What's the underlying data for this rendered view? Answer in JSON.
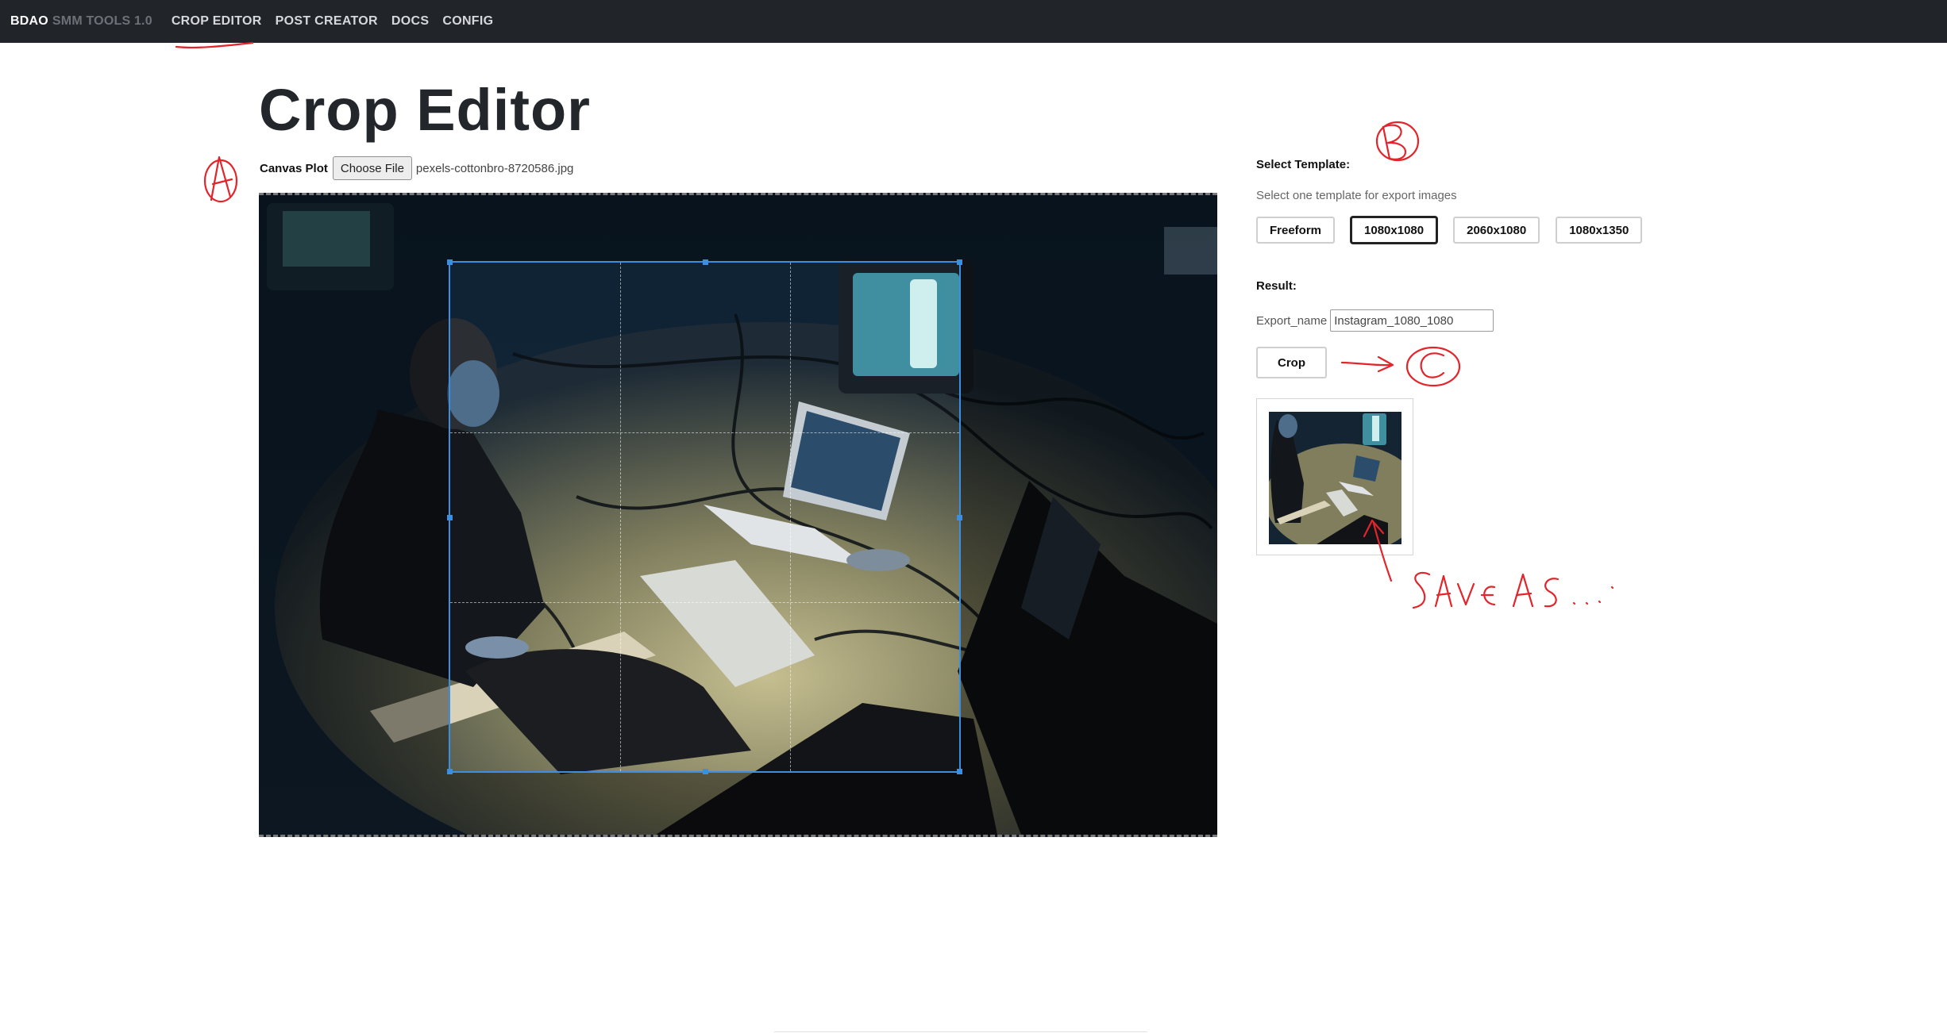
{
  "nav": {
    "brand_main": "BDAO",
    "brand_sub": "SMM TOOLS 1.0",
    "links": [
      "CROP EDITOR",
      "POST CREATOR",
      "DOCS",
      "CONFIG"
    ]
  },
  "page": {
    "title": "Crop Editor"
  },
  "file": {
    "label": "Canvas Plot",
    "button": "Choose File",
    "filename": "pexels-cottonbro-8720586.jpg"
  },
  "template": {
    "heading": "Select Template:",
    "helper": "Select one template for export images",
    "options": [
      "Freeform",
      "1080x1080",
      "2060x1080",
      "1080x1350"
    ],
    "selected": "1080x1080"
  },
  "result": {
    "heading": "Result:",
    "export_label": "Export_name",
    "export_value": "Instagram_1080_1080",
    "crop_button": "Crop"
  },
  "colors": {
    "navbar": "#212429",
    "crop_accent": "#3a8fe0",
    "annotation": "#e3242b"
  },
  "icons": {
    "annotations": [
      "letter-a-mark",
      "letter-b-mark",
      "arrow-to-c",
      "letter-c-mark",
      "arrow-up-mark"
    ]
  }
}
